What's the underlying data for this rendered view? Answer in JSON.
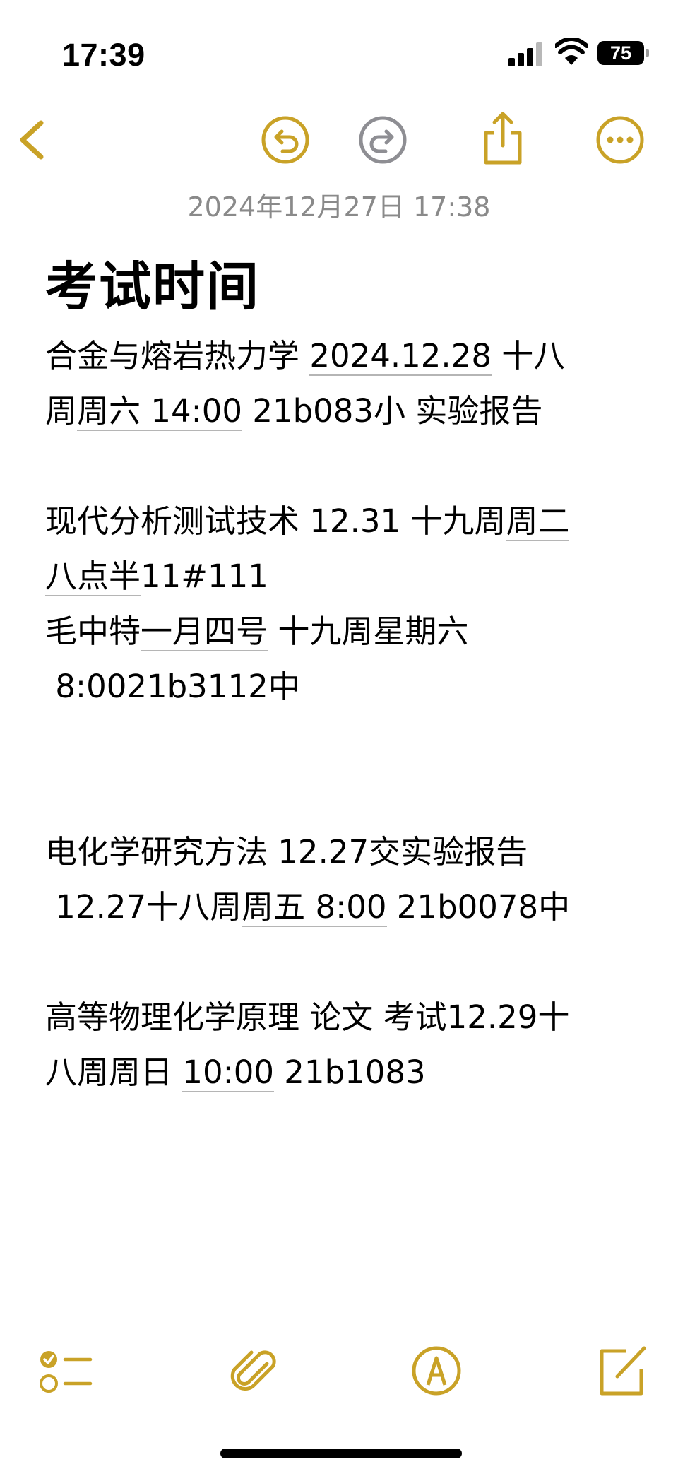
{
  "status_bar": {
    "time": "17:39",
    "battery_level": "75",
    "icons": [
      "signal-icon",
      "wifi-icon",
      "battery-icon"
    ]
  },
  "toolbar": {
    "icons": [
      "chevron-left-icon",
      "undo-icon",
      "redo-icon",
      "share-icon",
      "more-icon"
    ],
    "accent_color": "#C9A227",
    "disabled_color": "#8E8E93"
  },
  "note": {
    "date": "2024年12月27日 17:38",
    "title": "考试时间",
    "lines": [
      {
        "before": "合金与熔岩热力学 ",
        "link": "2024.12.28",
        "after": " 十八"
      },
      {
        "before": "周",
        "link": "周六 14:00",
        "after": " 21b083小 实验报告"
      },
      {
        "before": "",
        "link": "",
        "after": ""
      },
      {
        "before": "现代分析测试技术 12.31 十九周",
        "link": "周二",
        "after": ""
      },
      {
        "before": "",
        "link": "八点半",
        "after": "11#111"
      },
      {
        "before": "毛中特",
        "link": "一月四号",
        "after": " 十九周星期六"
      },
      {
        "before": " 8:0021b3112中",
        "link": "",
        "after": ""
      },
      {
        "before": "",
        "link": "",
        "after": ""
      },
      {
        "before": "",
        "link": "",
        "after": ""
      },
      {
        "before": "电化学研究方法 12.27交实验报告",
        "link": "",
        "after": ""
      },
      {
        "before": " 12.27十八周",
        "link": "周五 8:00",
        "after": " 21b0078中"
      },
      {
        "before": "",
        "link": "",
        "after": ""
      },
      {
        "before": "高等物理化学原理 论文 考试12.29十",
        "link": "",
        "after": ""
      },
      {
        "before": "八周周日 ",
        "link": "10:00",
        "after": " 21b1083"
      }
    ]
  },
  "bottom_toolbar": {
    "icons": [
      "checklist-icon",
      "paperclip-icon",
      "markup-icon",
      "compose-icon"
    ]
  }
}
